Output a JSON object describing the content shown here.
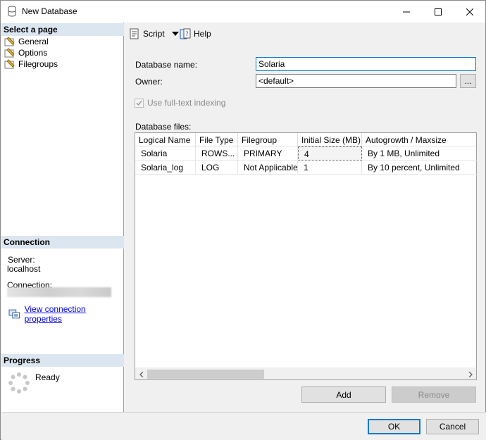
{
  "window": {
    "title": "New Database"
  },
  "left_panel": {
    "select_page_header": "Select a page",
    "pages": [
      {
        "label": "General",
        "icon": "wrench-page-icon"
      },
      {
        "label": "Options",
        "icon": "wrench-page-icon"
      },
      {
        "label": "Filegroups",
        "icon": "wrench-page-icon"
      }
    ],
    "connection_header": "Connection",
    "server_label": "Server:",
    "server_value": "localhost",
    "connection_label": "Connection:",
    "view_connection_link": "View connection properties",
    "progress_header": "Progress",
    "progress_status": "Ready"
  },
  "toolbar": {
    "script_label": "Script",
    "help_label": "Help"
  },
  "form": {
    "database_name_label": "Database name:",
    "database_name_value": "Solaria",
    "owner_label": "Owner:",
    "owner_value": "<default>",
    "owner_browse": "...",
    "fulltext_label": "Use full-text indexing",
    "fulltext_checked": true,
    "database_files_label": "Database files:"
  },
  "files_table": {
    "columns": [
      "Logical Name",
      "File Type",
      "Filegroup",
      "Initial Size (MB)",
      "Autogrowth / Maxsize"
    ],
    "rows": [
      [
        "Solaria",
        "ROWS...",
        "PRIMARY",
        "4",
        "By 1 MB, Unlimited"
      ],
      [
        "Solaria_log",
        "LOG",
        "Not Applicable",
        "1",
        "By 10 percent, Unlimited"
      ]
    ]
  },
  "buttons": {
    "add": "Add",
    "remove": "Remove",
    "ok": "OK",
    "cancel": "Cancel"
  },
  "colors": {
    "section_header_bg": "#dce6f1",
    "link": "#0000ee",
    "focus_border": "#0078d7"
  }
}
